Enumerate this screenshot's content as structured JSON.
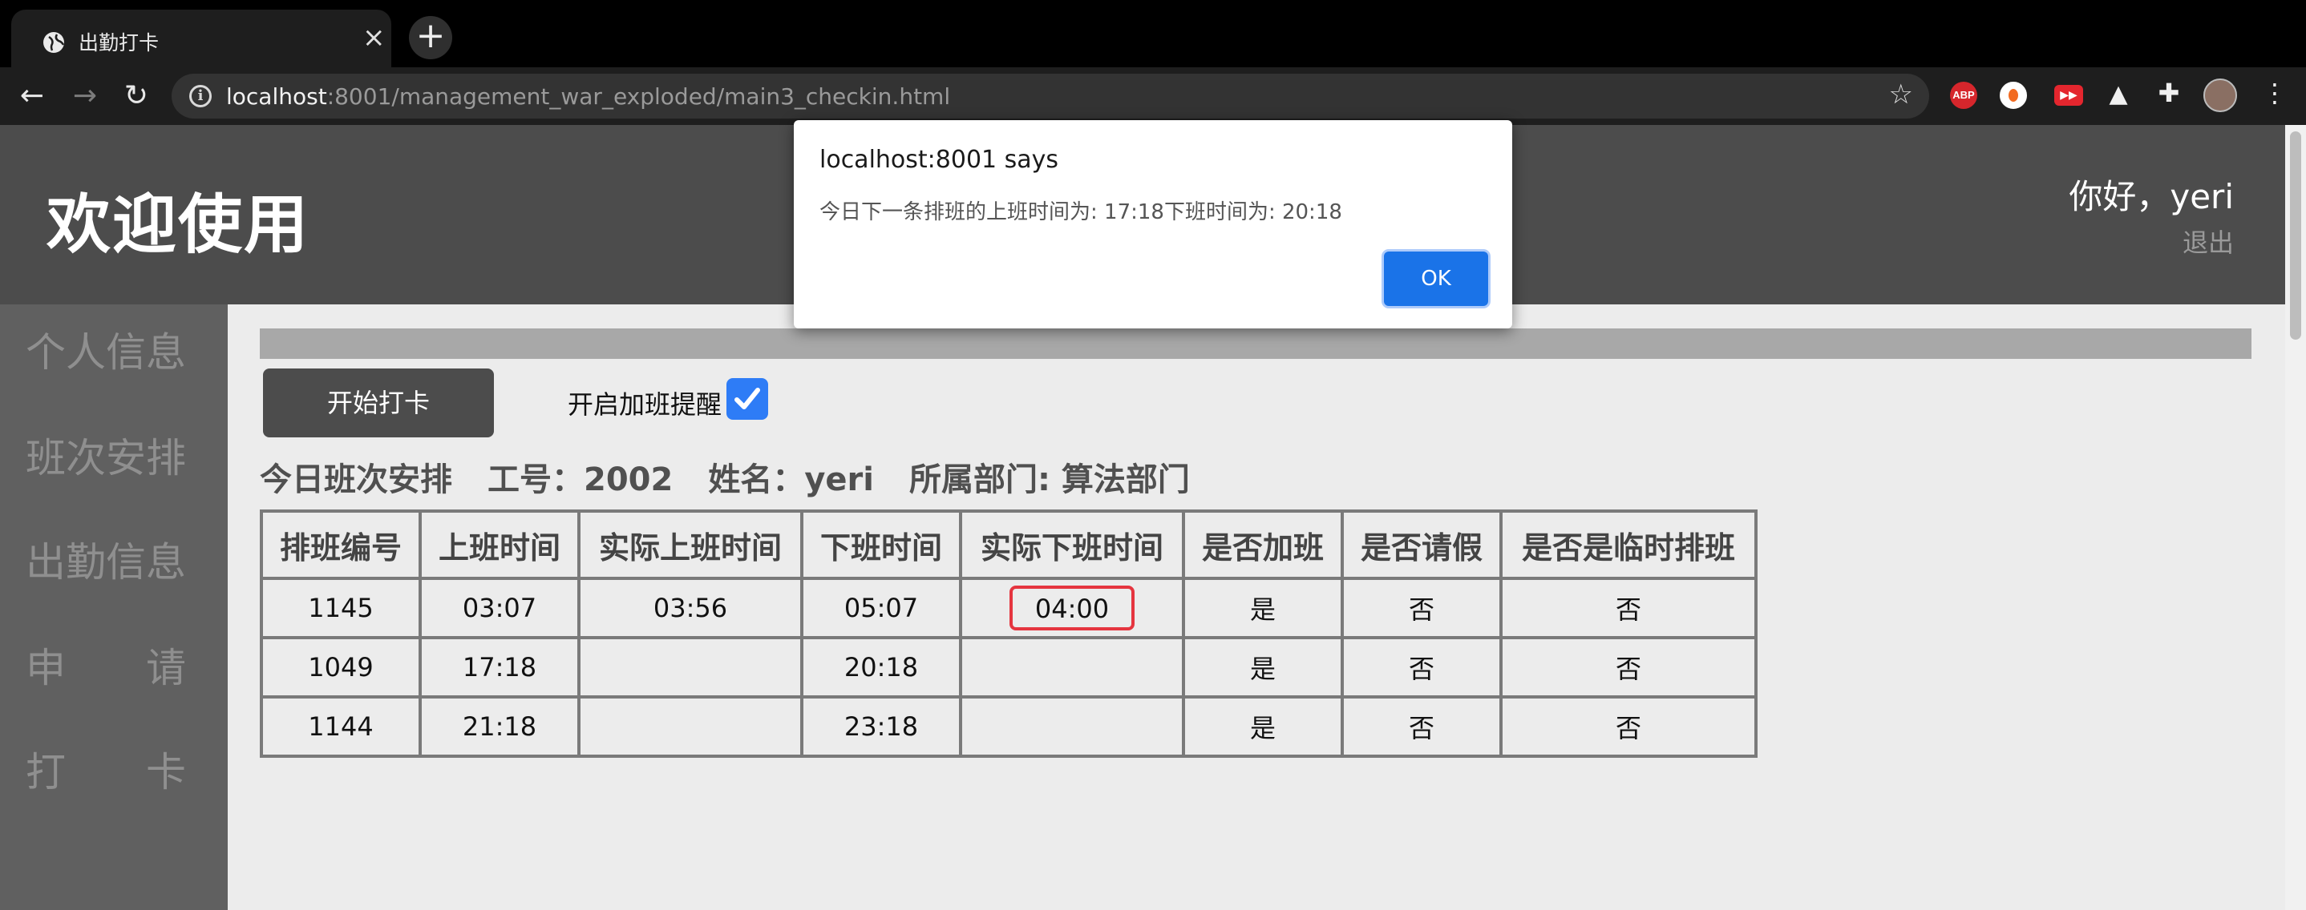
{
  "browser": {
    "tab_title": "出勤打卡",
    "tab_close": "×",
    "new_tab": "+",
    "url_host": "localhost",
    "url_rest": ":8001/management_war_exploded/main3_checkin.html",
    "extensions": [
      "abp",
      "orange",
      "youtube",
      "triangle",
      "puzzle",
      "avatar",
      "menu"
    ],
    "abp_label": "ABP"
  },
  "header": {
    "welcome": "欢迎使用",
    "greeting": "你好，yeri",
    "logout": "退出"
  },
  "sidebar": {
    "items": [
      "个人信息",
      "班次安排",
      "出勤信息",
      "申请",
      "打卡"
    ]
  },
  "main": {
    "start_button": "开始打卡",
    "overtime_label": "开启加班提醒",
    "overtime_checked": true,
    "info_title": "今日班次安排",
    "employee_id": "工号：2002",
    "employee_name": "姓名：yeri",
    "department": "所属部门: 算法部门"
  },
  "table": {
    "headers": [
      "排班编号",
      "上班时间",
      "实际上班时间",
      "下班时间",
      "实际下班时间",
      "是否加班",
      "是否请假",
      "是否是临时排班"
    ],
    "rows": [
      [
        "1145",
        "03:07",
        "03:56",
        "05:07",
        "04:00",
        "是",
        "否",
        "否"
      ],
      [
        "1049",
        "17:18",
        "",
        "20:18",
        "",
        "是",
        "否",
        "否"
      ],
      [
        "1144",
        "21:18",
        "",
        "23:18",
        "",
        "是",
        "否",
        "否"
      ]
    ]
  },
  "dialog": {
    "title": "localhost:8001 says",
    "message": "今日下一条排班的上班时间为: 17:18下班时间为: 20:18",
    "ok": "OK"
  },
  "colors": {
    "header_bg": "#4c4c4c",
    "sidebar_bg": "#606060",
    "accent_blue": "#1a73e8",
    "highlight_red": "#e5353f"
  }
}
